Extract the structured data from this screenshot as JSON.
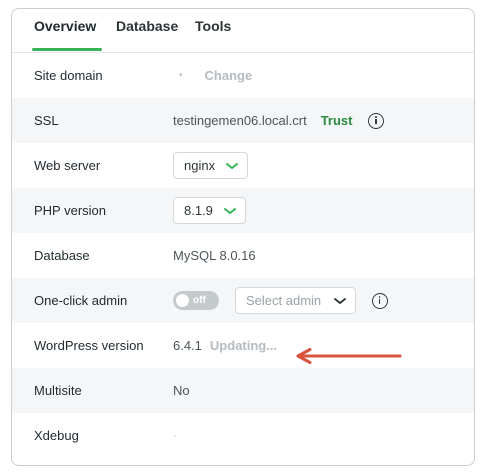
{
  "tabs": [
    {
      "label": "Overview",
      "active": true
    },
    {
      "label": "Database",
      "active": false
    },
    {
      "label": "Tools",
      "active": false
    }
  ],
  "rows": {
    "site_domain": {
      "label": "Site domain",
      "dot": "•",
      "change": "Change"
    },
    "ssl": {
      "label": "SSL",
      "cert": "testingemen06.local.crt",
      "trust": "Trust"
    },
    "web_server": {
      "label": "Web server",
      "value": "nginx"
    },
    "php_version": {
      "label": "PHP version",
      "value": "8.1.9"
    },
    "database": {
      "label": "Database",
      "value": "MySQL 8.0.16"
    },
    "one_click_admin": {
      "label": "One-click admin",
      "toggle": "off",
      "toggle_on": false,
      "select_placeholder": "Select admin"
    },
    "wordpress_version": {
      "label": "WordPress version",
      "value": "6.4.1",
      "status": "Updating..."
    },
    "multisite": {
      "label": "Multisite",
      "value": "No"
    },
    "xdebug": {
      "label": "Xdebug",
      "value": "·"
    }
  },
  "colors": {
    "accent": "#37b35a",
    "trust": "#2a8a3e",
    "arrow": "#d9533c",
    "shaded_row": "#f5f6f7"
  },
  "icons": {
    "info": "info-icon",
    "chevron": "chevron-down-icon",
    "arrow": "arrow-left-icon"
  }
}
